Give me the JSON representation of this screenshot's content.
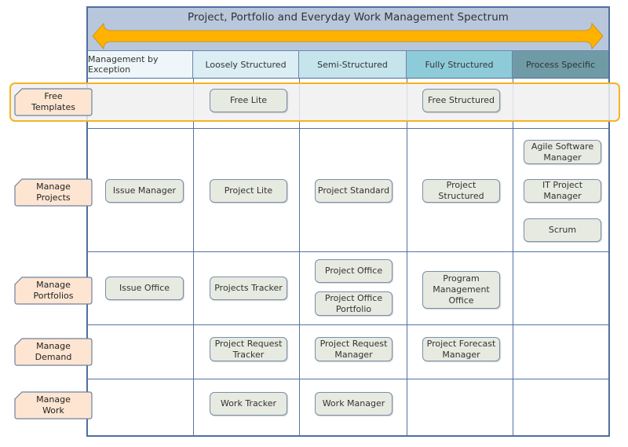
{
  "title": "Project, Portfolio and Everyday Work Management Spectrum",
  "colors": {
    "title_band": "#b8c7dc",
    "arrow": "#ffb300",
    "highlight_border": "#f5b324",
    "row_label_fill": "#fde5d2",
    "template_fill": "#e7eae0",
    "grid_line": "#5373a3"
  },
  "columns": [
    {
      "label": "Management by Exception",
      "color": "#eef6f9"
    },
    {
      "label": "Loosely Structured",
      "color": "#daeef3"
    },
    {
      "label": "Semi-Structured",
      "color": "#c5e4ec"
    },
    {
      "label": "Fully Structured",
      "color": "#8ecbd8"
    },
    {
      "label": "Process Specific",
      "color": "#6f9ba6"
    }
  ],
  "rows": [
    {
      "label_line1": "Free",
      "label_line2": "Templates"
    },
    {
      "label_line1": "Manage",
      "label_line2": "Projects"
    },
    {
      "label_line1": "Manage",
      "label_line2": "Portfolios"
    },
    {
      "label_line1": "Manage",
      "label_line2": "Demand"
    },
    {
      "label_line1": "Manage",
      "label_line2": "Work"
    }
  ],
  "templates": {
    "free_lite": "Free Lite",
    "free_structured": "Free Structured",
    "issue_manager": "Issue Manager",
    "project_lite": "Project Lite",
    "project_standard": "Project Standard",
    "project_structured": "Project Structured",
    "agile_software_manager_1": "Agile Software",
    "agile_software_manager_2": "Manager",
    "it_project_manager": "IT Project Manager",
    "scrum": "Scrum",
    "issue_office": "Issue Office",
    "projects_tracker": "Projects Tracker",
    "project_office": "Project Office",
    "project_office_portfolio_1": "Project Office",
    "project_office_portfolio_2": "Portfolio",
    "program_management_office_1": "Program",
    "program_management_office_2": "Management Office",
    "project_request_tracker_1": "Project Request",
    "project_request_tracker_2": "Tracker",
    "project_request_manager_1": "Project Request",
    "project_request_manager_2": "Manager",
    "project_forecast_manager_1": "Project Forecast",
    "project_forecast_manager_2": "Manager",
    "work_tracker": "Work Tracker",
    "work_manager": "Work Manager"
  }
}
